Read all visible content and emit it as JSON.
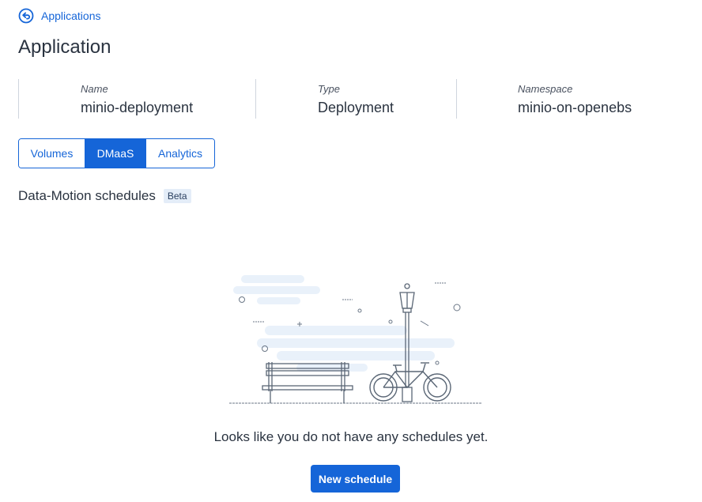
{
  "nav": {
    "back_label": "Applications"
  },
  "page": {
    "title": "Application"
  },
  "info": {
    "name_label": "Name",
    "name_value": "minio-deployment",
    "type_label": "Type",
    "type_value": "Deployment",
    "namespace_label": "Namespace",
    "namespace_value": "minio-on-openebs"
  },
  "tabs": [
    {
      "label": "Volumes",
      "active": false
    },
    {
      "label": "DMaaS",
      "active": true
    },
    {
      "label": "Analytics",
      "active": false
    }
  ],
  "section": {
    "title": "Data-Motion schedules",
    "badge": "Beta"
  },
  "empty_state": {
    "message": "Looks like you do not have any schedules yet.",
    "illustration": "park-bench-bicycle-illustration"
  },
  "actions": {
    "new_schedule_label": "New schedule"
  },
  "colors": {
    "primary": "#1565d8",
    "text": "#2a3340",
    "badge_bg": "#e4edf8"
  }
}
